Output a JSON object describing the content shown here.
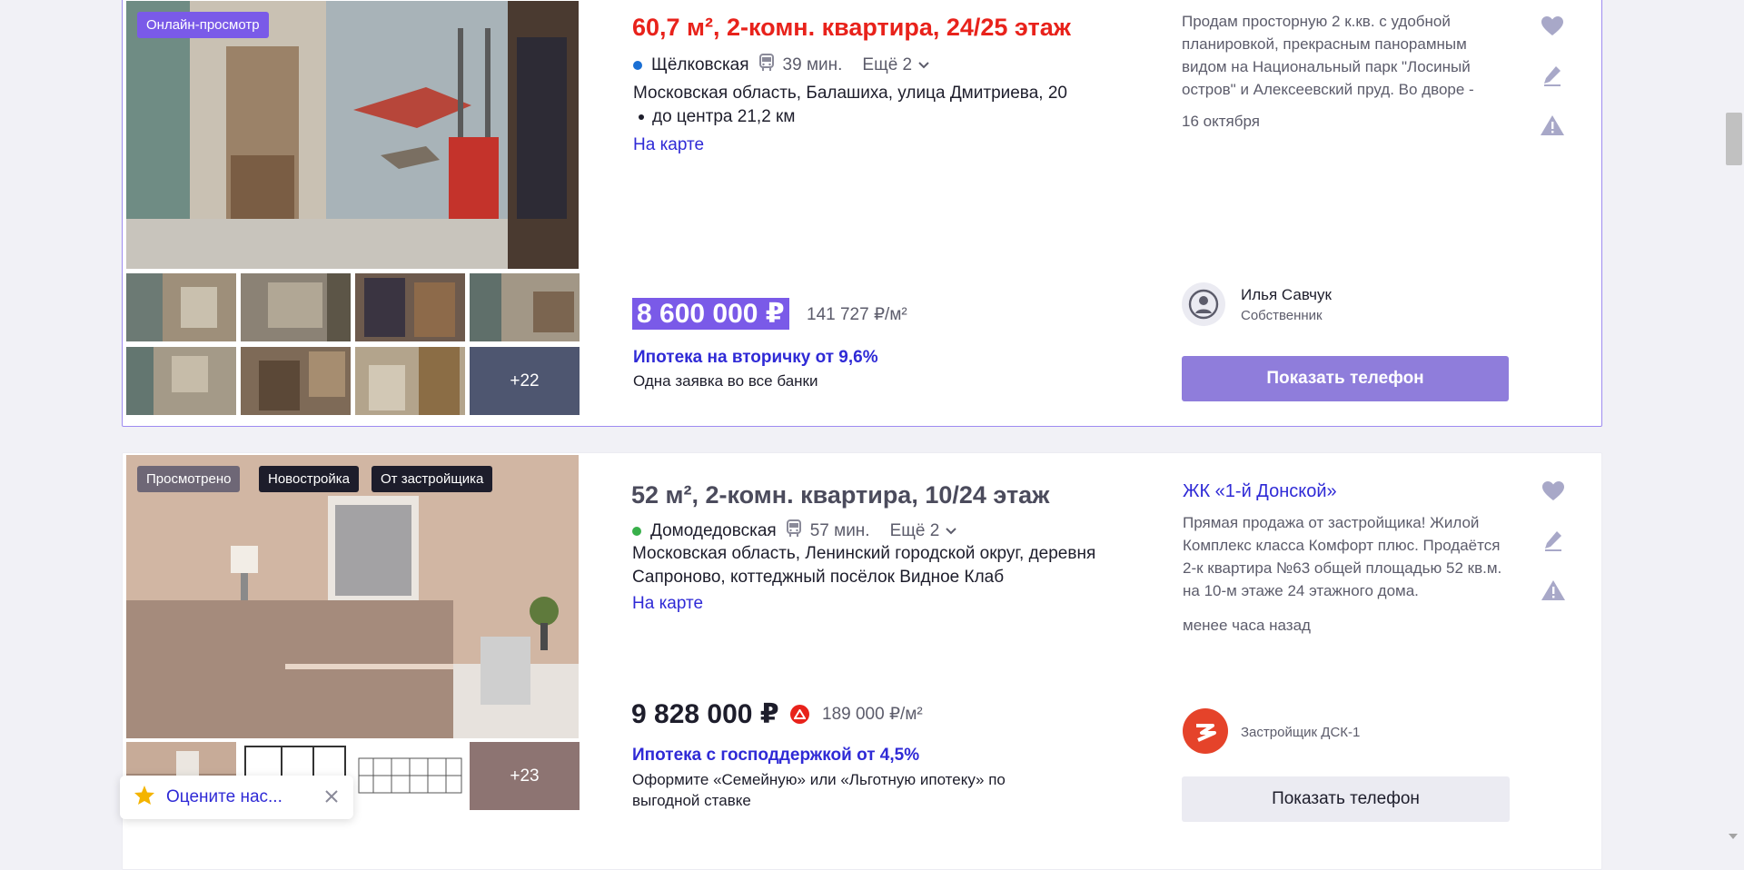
{
  "listing1": {
    "badge": "Онлайн-просмотр",
    "title": "60,7 м², 2-комн. квартира, 24/25 этаж",
    "metro_station": "Щёлковская",
    "metro_time": "39 мин.",
    "more_label": "Ещё 2",
    "address_line1": "Московская область, Балашиха, улица Дмитриева, 20",
    "address_line2": "до центра 21,2 км",
    "map_link": "На карте",
    "price": "8 600 000 ₽",
    "price_per_m2": "141 727 ₽/м²",
    "mortgage_title": "Ипотека на вторичку от 9,6%",
    "mortgage_sub": "Одна заявка во все банки",
    "description": "Продам просторную 2 к.кв. с удобной планировкой, прекрасным панорамным видом на Национальный парк \"Лосиный остров\" и Алексеевский пруд. Во дворе -",
    "date": "16 октября",
    "agent_name": "Илья Савчук",
    "agent_role": "Собственник",
    "phone_button": "Показать телефон",
    "more_photos": "+22",
    "colors": {
      "title": "#e8221b",
      "metro_dot": "#1a6fd4",
      "button_bg": "#8f7ddb",
      "price_bg": "#7a5ae8"
    }
  },
  "listing2": {
    "badges": [
      "Просмотрено",
      "Новостройка",
      "От застройщика"
    ],
    "title": "52 м², 2-комн. квартира, 10/24 этаж",
    "metro_station": "Домодедовская",
    "metro_time": "57 мин.",
    "more_label": "Ещё 2",
    "address": "Московская область, Ленинский городской округ, деревня Сапроново, коттеджный посёлок Видное Клаб",
    "map_link": "На карте",
    "price": "9 828 000 ₽",
    "price_per_m2": "189 000 ₽/м²",
    "mortgage_title": "Ипотека с господдержкой от 4,5%",
    "mortgage_sub": "Оформите «Семейную» или «Льготную ипотеку» по выгодной ставке",
    "complex_name": "ЖК «1-й Донской»",
    "description": "Прямая продажа от застройщика! Жилой Комплекс класса Комфорт плюс. Продаётся 2-к квартира №63 общей площадью 52 кв.м. на 10-м этаже 24 этажного дома.",
    "date": "менее часа назад",
    "developer": "Застройщик ДСК-1",
    "phone_button": "Показать телефон",
    "more_photos": "+23",
    "colors": {
      "title": "#4b4b5c",
      "metro_dot": "#38b04a",
      "button_bg": "#ebebf2",
      "logo": "#e5432a"
    }
  },
  "rate_popup": {
    "label": "Оцените нас..."
  },
  "icons": [
    "heart-icon",
    "pencil-icon",
    "warning-icon",
    "bus-icon",
    "chevron-down-icon",
    "user-avatar-icon",
    "star-icon",
    "close-icon",
    "price-up-icon",
    "developer-logo-icon"
  ]
}
